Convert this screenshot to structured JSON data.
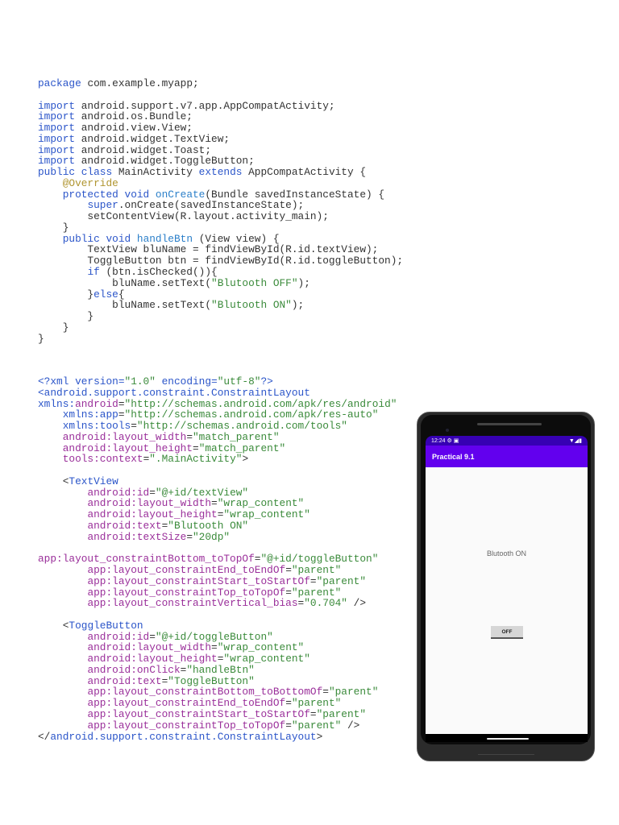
{
  "java_code": [
    [
      [
        "package",
        "k"
      ],
      [
        " com.example.myapp;",
        "p"
      ]
    ],
    [],
    [
      [
        "import",
        "k"
      ],
      [
        " android.support.v7.app.AppCompatActivity;",
        "p"
      ]
    ],
    [
      [
        "import",
        "k"
      ],
      [
        " android.os.Bundle;",
        "p"
      ]
    ],
    [
      [
        "import",
        "k"
      ],
      [
        " android.view.View;",
        "p"
      ]
    ],
    [
      [
        "import",
        "k"
      ],
      [
        " android.widget.TextView;",
        "p"
      ]
    ],
    [
      [
        "import",
        "k"
      ],
      [
        " android.widget.Toast;",
        "p"
      ]
    ],
    [
      [
        "import",
        "k"
      ],
      [
        " android.widget.ToggleButton;",
        "p"
      ]
    ],
    [
      [
        "public class",
        "k"
      ],
      [
        " MainActivity ",
        "p"
      ],
      [
        "extends",
        "k"
      ],
      [
        " AppCompatActivity {",
        "p"
      ]
    ],
    [
      [
        "    ",
        "p"
      ],
      [
        "@Override",
        "a"
      ]
    ],
    [
      [
        "    ",
        "p"
      ],
      [
        "protected void",
        "k"
      ],
      [
        " ",
        "p"
      ],
      [
        "onCreate",
        "m"
      ],
      [
        "(Bundle savedInstanceState) {",
        "p"
      ]
    ],
    [
      [
        "        ",
        "p"
      ],
      [
        "super",
        "k"
      ],
      [
        ".onCreate(savedInstanceState);",
        "p"
      ]
    ],
    [
      [
        "        setContentView(R.layout.activity_main);",
        "p"
      ]
    ],
    [
      [
        "    }",
        "p"
      ]
    ],
    [
      [
        "    ",
        "p"
      ],
      [
        "public void",
        "k"
      ],
      [
        " ",
        "p"
      ],
      [
        "handleBtn",
        "m"
      ],
      [
        " (View view) {",
        "p"
      ]
    ],
    [
      [
        "        TextView bluName = findViewById(R.id.textView);",
        "p"
      ]
    ],
    [
      [
        "        ToggleButton btn = findViewById(R.id.toggleButton);",
        "p"
      ]
    ],
    [
      [
        "        ",
        "p"
      ],
      [
        "if",
        "k"
      ],
      [
        " (btn.isChecked()){",
        "p"
      ]
    ],
    [
      [
        "            bluName.setText(",
        "p"
      ],
      [
        "\"Blutooth OFF\"",
        "s"
      ],
      [
        ");",
        "p"
      ]
    ],
    [
      [
        "        }",
        "p"
      ],
      [
        "else",
        "k"
      ],
      [
        "{",
        "p"
      ]
    ],
    [
      [
        "            bluName.setText(",
        "p"
      ],
      [
        "\"Blutooth ON\"",
        "s"
      ],
      [
        ");",
        "p"
      ]
    ],
    [
      [
        "        }",
        "p"
      ]
    ],
    [
      [
        "    }",
        "p"
      ]
    ],
    [
      [
        "}",
        "p"
      ]
    ]
  ],
  "xml_code": [
    [
      [
        "<?xml ",
        "t"
      ],
      [
        "version=",
        "t"
      ],
      [
        "\"1.0\"",
        "s"
      ],
      [
        " encoding=",
        "t"
      ],
      [
        "\"utf-8\"",
        "s"
      ],
      [
        "?>",
        "t"
      ]
    ],
    [
      [
        "<android.support.constraint.ConstraintLayout",
        "t"
      ]
    ],
    [
      [
        "xmlns:",
        "t"
      ],
      [
        "android",
        "at"
      ],
      [
        "=",
        "p"
      ],
      [
        "\"http://schemas.android.com/apk/res/android\"",
        "s"
      ]
    ],
    [
      [
        "    ",
        "p"
      ],
      [
        "xmlns:app",
        "t"
      ],
      [
        "=",
        "p"
      ],
      [
        "\"http://schemas.android.com/apk/res-auto\"",
        "s"
      ]
    ],
    [
      [
        "    ",
        "p"
      ],
      [
        "xmlns:tools",
        "t"
      ],
      [
        "=",
        "p"
      ],
      [
        "\"http://schemas.android.com/tools\"",
        "s"
      ]
    ],
    [
      [
        "    ",
        "p"
      ],
      [
        "android:layout_width",
        "at"
      ],
      [
        "=",
        "p"
      ],
      [
        "\"match_parent\"",
        "s"
      ]
    ],
    [
      [
        "    ",
        "p"
      ],
      [
        "android:layout_height",
        "at"
      ],
      [
        "=",
        "p"
      ],
      [
        "\"match_parent\"",
        "s"
      ]
    ],
    [
      [
        "    ",
        "p"
      ],
      [
        "tools:context",
        "at"
      ],
      [
        "=",
        "p"
      ],
      [
        "\".MainActivity\"",
        "s"
      ],
      [
        ">",
        "p"
      ]
    ],
    [],
    [
      [
        "    <",
        "p"
      ],
      [
        "TextView",
        "t"
      ]
    ],
    [
      [
        "        ",
        "p"
      ],
      [
        "android:id",
        "at"
      ],
      [
        "=",
        "p"
      ],
      [
        "\"@+id/textView\"",
        "s"
      ]
    ],
    [
      [
        "        ",
        "p"
      ],
      [
        "android:layout_width",
        "at"
      ],
      [
        "=",
        "p"
      ],
      [
        "\"wrap_content\"",
        "s"
      ]
    ],
    [
      [
        "        ",
        "p"
      ],
      [
        "android:layout_height",
        "at"
      ],
      [
        "=",
        "p"
      ],
      [
        "\"wrap_content\"",
        "s"
      ]
    ],
    [
      [
        "        ",
        "p"
      ],
      [
        "android:text",
        "at"
      ],
      [
        "=",
        "p"
      ],
      [
        "\"Blutooth ON\"",
        "s"
      ]
    ],
    [
      [
        "        ",
        "p"
      ],
      [
        "android:textSize",
        "at"
      ],
      [
        "=",
        "p"
      ],
      [
        "\"20dp\"",
        "s"
      ]
    ],
    [],
    [
      [
        "app:layout_constraintBottom_toTopOf",
        "at"
      ],
      [
        "=",
        "p"
      ],
      [
        "\"@+id/toggleButton\"",
        "s"
      ]
    ],
    [
      [
        "        ",
        "p"
      ],
      [
        "app:layout_constraintEnd_toEndOf",
        "at"
      ],
      [
        "=",
        "p"
      ],
      [
        "\"parent\"",
        "s"
      ]
    ],
    [
      [
        "        ",
        "p"
      ],
      [
        "app:layout_constraintStart_toStartOf",
        "at"
      ],
      [
        "=",
        "p"
      ],
      [
        "\"parent\"",
        "s"
      ]
    ],
    [
      [
        "        ",
        "p"
      ],
      [
        "app:layout_constraintTop_toTopOf",
        "at"
      ],
      [
        "=",
        "p"
      ],
      [
        "\"parent\"",
        "s"
      ]
    ],
    [
      [
        "        ",
        "p"
      ],
      [
        "app:layout_constraintVertical_bias",
        "at"
      ],
      [
        "=",
        "p"
      ],
      [
        "\"0.704\"",
        "s"
      ],
      [
        " />",
        "p"
      ]
    ],
    [],
    [
      [
        "    <",
        "p"
      ],
      [
        "ToggleButton",
        "t"
      ]
    ],
    [
      [
        "        ",
        "p"
      ],
      [
        "android:id",
        "at"
      ],
      [
        "=",
        "p"
      ],
      [
        "\"@+id/toggleButton\"",
        "s"
      ]
    ],
    [
      [
        "        ",
        "p"
      ],
      [
        "android:layout_width",
        "at"
      ],
      [
        "=",
        "p"
      ],
      [
        "\"wrap_content\"",
        "s"
      ]
    ],
    [
      [
        "        ",
        "p"
      ],
      [
        "android:layout_height",
        "at"
      ],
      [
        "=",
        "p"
      ],
      [
        "\"wrap_content\"",
        "s"
      ]
    ],
    [
      [
        "        ",
        "p"
      ],
      [
        "android:onClick",
        "at"
      ],
      [
        "=",
        "p"
      ],
      [
        "\"handleBtn\"",
        "s"
      ]
    ],
    [
      [
        "        ",
        "p"
      ],
      [
        "android:text",
        "at"
      ],
      [
        "=",
        "p"
      ],
      [
        "\"ToggleButton\"",
        "s"
      ]
    ],
    [
      [
        "        ",
        "p"
      ],
      [
        "app:layout_constraintBottom_toBottomOf",
        "at"
      ],
      [
        "=",
        "p"
      ],
      [
        "\"parent\"",
        "s"
      ]
    ],
    [
      [
        "        ",
        "p"
      ],
      [
        "app:layout_constraintEnd_toEndOf",
        "at"
      ],
      [
        "=",
        "p"
      ],
      [
        "\"parent\"",
        "s"
      ]
    ],
    [
      [
        "        ",
        "p"
      ],
      [
        "app:layout_constraintStart_toStartOf",
        "at"
      ],
      [
        "=",
        "p"
      ],
      [
        "\"parent\"",
        "s"
      ]
    ],
    [
      [
        "        ",
        "p"
      ],
      [
        "app:layout_constraintTop_toTopOf",
        "at"
      ],
      [
        "=",
        "p"
      ],
      [
        "\"parent\"",
        "s"
      ],
      [
        " />",
        "p"
      ]
    ],
    [
      [
        "</",
        "p"
      ],
      [
        "android.support.constraint.ConstraintLayout",
        "t"
      ],
      [
        ">",
        "p"
      ]
    ]
  ],
  "phone": {
    "status_time": "12:24",
    "status_icons_left": "⚙ ▣",
    "status_icons_right": "▼◢▮",
    "app_title": "Practical 9.1",
    "text_view": "Blutooth ON",
    "toggle_button": "OFF",
    "colors": {
      "status_bar": "#3700b3",
      "app_bar": "#6200ee"
    }
  }
}
